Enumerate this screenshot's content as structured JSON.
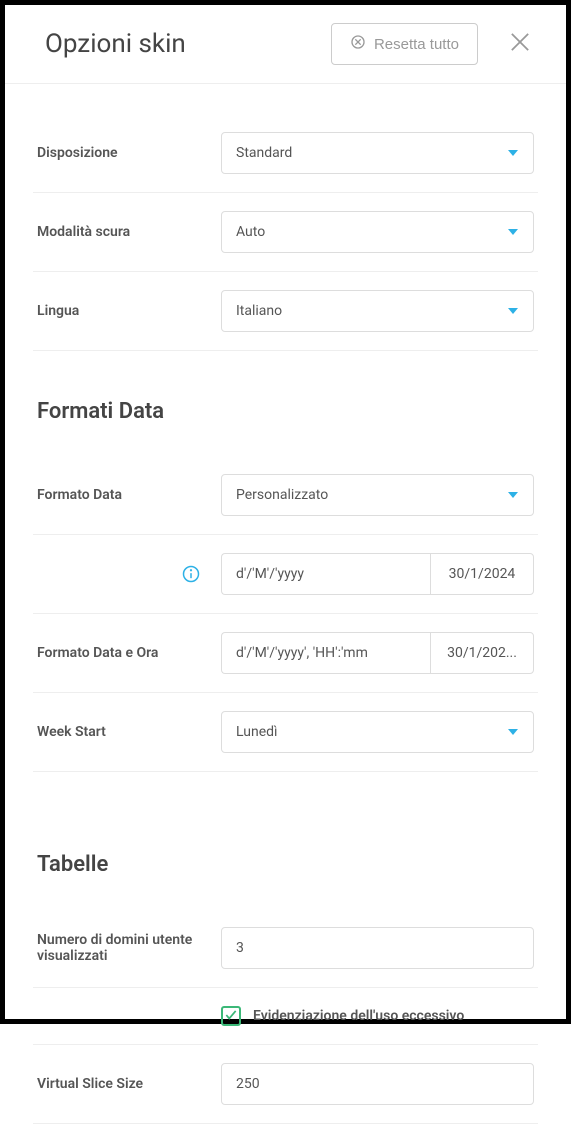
{
  "header": {
    "title": "Opzioni skin",
    "reset_label": "Resetta tutto"
  },
  "rows": {
    "layout": {
      "label": "Disposizione",
      "value": "Standard"
    },
    "dark": {
      "label": "Modalità scura",
      "value": "Auto"
    },
    "lang": {
      "label": "Lingua",
      "value": "Italiano"
    }
  },
  "date_section": {
    "heading": "Formati Data",
    "format": {
      "label": "Formato Data",
      "value": "Personalizzato"
    },
    "custom": {
      "value": "d'/'M'/'yyyy",
      "preview": "30/1/2024"
    },
    "datetime": {
      "label": "Formato Data e Ora",
      "value": "d'/'M'/'yyyy', 'HH':'mm",
      "preview": "30/1/202..."
    },
    "weekstart": {
      "label": "Week Start",
      "value": "Lunedì"
    }
  },
  "tables_section": {
    "heading": "Tabelle",
    "domains": {
      "label": "Numero di domini utente visualizzati",
      "value": "3"
    },
    "highlight": {
      "label": "Evidenziazione dell'uso eccessivo",
      "checked": true
    },
    "slice": {
      "label": "Virtual Slice Size",
      "value": "250"
    }
  }
}
